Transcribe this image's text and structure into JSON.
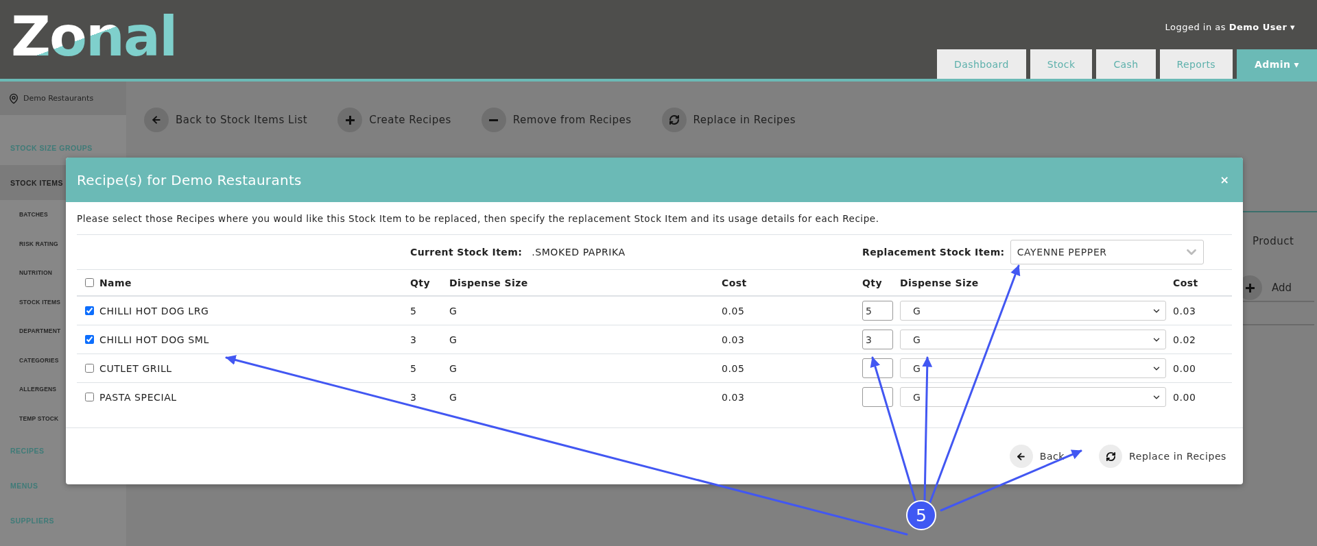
{
  "header": {
    "logo": "Zonal",
    "user_prefix": "Logged in as",
    "user_name": "Demo User",
    "caret": "▾",
    "nav": [
      {
        "label": "Dashboard",
        "selected": false
      },
      {
        "label": "Stock",
        "selected": false
      },
      {
        "label": "Cash",
        "selected": false
      },
      {
        "label": "Reports",
        "selected": false
      },
      {
        "label": "Admin",
        "selected": true
      }
    ]
  },
  "sidebar": {
    "location": "Demo Restaurants",
    "items": [
      {
        "label": "STOCK SIZE GROUPS",
        "selected": false
      },
      {
        "label": "STOCK ITEMS",
        "selected": true,
        "children": [
          {
            "label": "BATCHES"
          },
          {
            "label": "RISK RATING"
          },
          {
            "label": "NUTRITION"
          },
          {
            "label": "STOCK ITEMS"
          },
          {
            "label": "DEPARTMENT"
          },
          {
            "label": "CATEGORIES"
          },
          {
            "label": "ALLERGENS"
          },
          {
            "label": "TEMP STOCK"
          }
        ]
      },
      {
        "label": "RECIPES",
        "selected": false
      },
      {
        "label": "MENUS",
        "selected": false
      },
      {
        "label": "SUPPLIERS",
        "selected": false
      }
    ]
  },
  "toolbar": [
    {
      "label": "Back to Stock Items List",
      "kind": "back"
    },
    {
      "label": "Create Recipes",
      "kind": "create"
    },
    {
      "label": "Remove from Recipes",
      "kind": "remove"
    },
    {
      "label": "Replace in Recipes",
      "kind": "replace"
    }
  ],
  "page": {
    "side_text": "Product",
    "add_button": "Add"
  },
  "modal": {
    "title": "Recipe(s) for Demo Restaurants",
    "close": "×",
    "instructions": "Please select those Recipes where you would like this Stock Item to be replaced, then specify the replacement Stock Item and its usage details for each Recipe.",
    "current_label": "Current Stock Item:",
    "current_value": ".SMOKED PAPRIKA",
    "replacement_label": "Replacement Stock Item:",
    "replacement_value": "CAYENNE PEPPER",
    "select_all_checked": false,
    "columns": [
      "Name",
      "Qty",
      "Dispense Size",
      "Cost",
      "Qty",
      "Dispense Size",
      "Cost"
    ],
    "rows": [
      {
        "name": "CHILLI HOT DOG LRG",
        "qty": "5",
        "size": "G",
        "cost": "0.05",
        "new_qty": "5",
        "new_size": "G",
        "new_cost": "0.03",
        "checked": true
      },
      {
        "name": "CHILLI HOT DOG SML",
        "qty": "3",
        "size": "G",
        "cost": "0.03",
        "new_qty": "3",
        "new_size": "G",
        "new_cost": "0.02",
        "checked": true
      },
      {
        "name": "CUTLET GRILL",
        "qty": "5",
        "size": "G",
        "cost": "0.05",
        "new_size": "G",
        "new_cost": "0.00",
        "checked": false
      },
      {
        "name": "PASTA SPECIAL",
        "qty": "3",
        "size": "G",
        "cost": "0.03",
        "new_size": "G",
        "new_cost": "0.00",
        "checked": false
      }
    ],
    "buttons": [
      {
        "label": "Back",
        "kind": "back"
      },
      {
        "label": "Replace in Recipes",
        "kind": "replace"
      }
    ]
  },
  "annotation": {
    "badge": "5"
  }
}
